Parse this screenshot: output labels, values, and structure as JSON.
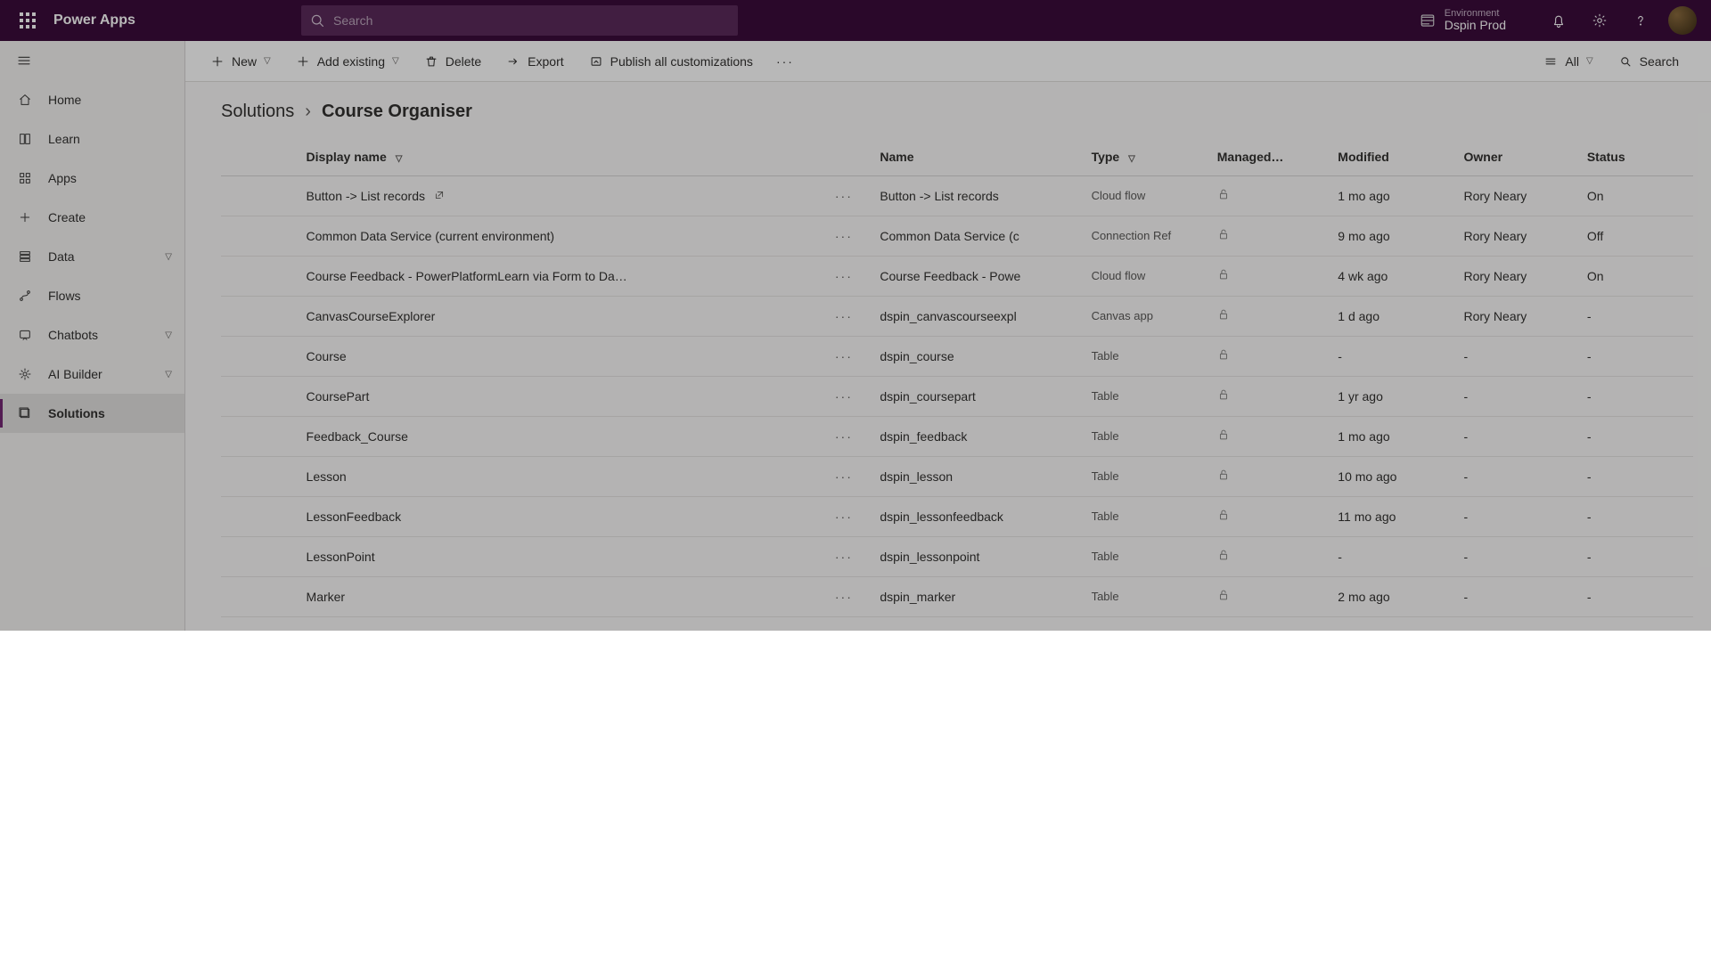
{
  "header": {
    "app_name": "Power Apps",
    "search_placeholder": "Search",
    "env_label": "Environment",
    "env_name": "Dspin Prod"
  },
  "sidenav": {
    "items": [
      {
        "label": "Home",
        "icon": "home-icon",
        "expandable": false,
        "active": false
      },
      {
        "label": "Learn",
        "icon": "book-icon",
        "expandable": false,
        "active": false
      },
      {
        "label": "Apps",
        "icon": "apps-icon",
        "expandable": false,
        "active": false
      },
      {
        "label": "Create",
        "icon": "plus-icon",
        "expandable": false,
        "active": false
      },
      {
        "label": "Data",
        "icon": "data-icon",
        "expandable": true,
        "active": false
      },
      {
        "label": "Flows",
        "icon": "flow-icon",
        "expandable": false,
        "active": false
      },
      {
        "label": "Chatbots",
        "icon": "chatbot-icon",
        "expandable": true,
        "active": false
      },
      {
        "label": "AI Builder",
        "icon": "ai-icon",
        "expandable": true,
        "active": false
      },
      {
        "label": "Solutions",
        "icon": "solutions-icon",
        "expandable": false,
        "active": true
      }
    ]
  },
  "commandbar": {
    "new": "New",
    "add_existing": "Add existing",
    "delete": "Delete",
    "export": "Export",
    "publish": "Publish all customizations",
    "view_all": "All",
    "search": "Search"
  },
  "breadcrumb": {
    "root": "Solutions",
    "current": "Course Organiser"
  },
  "columns": {
    "display_name": "Display name",
    "name": "Name",
    "type": "Type",
    "managed": "Managed…",
    "modified": "Modified",
    "owner": "Owner",
    "status": "Status"
  },
  "rows": [
    {
      "display": "Button -> List records",
      "open_icon": true,
      "name": "Button -> List records",
      "type": "Cloud flow",
      "locked": true,
      "modified": "1 mo ago",
      "owner": "Rory Neary",
      "status": "On"
    },
    {
      "display": "Common Data Service (current environment)",
      "open_icon": false,
      "name": "Common Data Service (c",
      "type": "Connection Ref",
      "locked": true,
      "modified": "9 mo ago",
      "owner": "Rory Neary",
      "status": "Off"
    },
    {
      "display": "Course Feedback - PowerPlatformLearn via Form to Da…",
      "open_icon": false,
      "name": "Course Feedback - Powe",
      "type": "Cloud flow",
      "locked": true,
      "modified": "4 wk ago",
      "owner": "Rory Neary",
      "status": "On"
    },
    {
      "display": "CanvasCourseExplorer",
      "open_icon": false,
      "name": "dspin_canvascourseexpl",
      "type": "Canvas app",
      "locked": true,
      "modified": "1 d ago",
      "owner": "Rory Neary",
      "status": "-"
    },
    {
      "display": "Course",
      "open_icon": false,
      "name": "dspin_course",
      "type": "Table",
      "locked": true,
      "modified": "-",
      "owner": "-",
      "status": "-"
    },
    {
      "display": "CoursePart",
      "open_icon": false,
      "name": "dspin_coursepart",
      "type": "Table",
      "locked": true,
      "modified": "1 yr ago",
      "owner": "-",
      "status": "-"
    },
    {
      "display": "Feedback_Course",
      "open_icon": false,
      "name": "dspin_feedback",
      "type": "Table",
      "locked": true,
      "modified": "1 mo ago",
      "owner": "-",
      "status": "-"
    },
    {
      "display": "Lesson",
      "open_icon": false,
      "name": "dspin_lesson",
      "type": "Table",
      "locked": true,
      "modified": "10 mo ago",
      "owner": "-",
      "status": "-"
    },
    {
      "display": "LessonFeedback",
      "open_icon": false,
      "name": "dspin_lessonfeedback",
      "type": "Table",
      "locked": true,
      "modified": "11 mo ago",
      "owner": "-",
      "status": "-"
    },
    {
      "display": "LessonPoint",
      "open_icon": false,
      "name": "dspin_lessonpoint",
      "type": "Table",
      "locked": true,
      "modified": "-",
      "owner": "-",
      "status": "-"
    },
    {
      "display": "Marker",
      "open_icon": false,
      "name": "dspin_marker",
      "type": "Table",
      "locked": true,
      "modified": "2 mo ago",
      "owner": "-",
      "status": "-"
    }
  ]
}
